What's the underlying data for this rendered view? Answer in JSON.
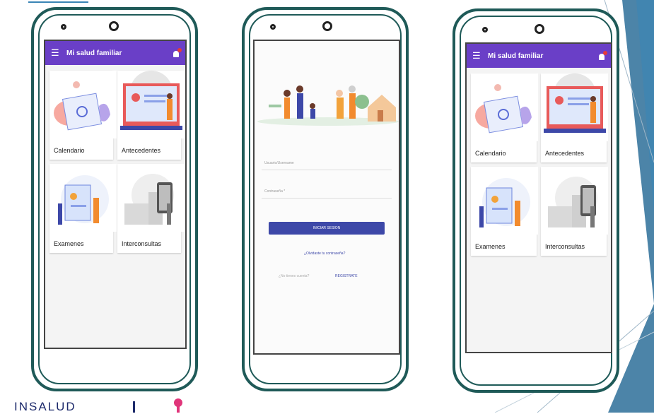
{
  "app": {
    "title": "Mi salud familiar",
    "menu_icon": "menu-icon",
    "notification_icon": "bell-icon",
    "brand_color": "#6a3fc7"
  },
  "dashboard": {
    "cards": [
      {
        "label": "Calendario"
      },
      {
        "label": "Antecedentes"
      },
      {
        "label": "Examenes"
      },
      {
        "label": "Interconsultas"
      }
    ]
  },
  "login": {
    "user_placeholder": "Usuario/Username",
    "password_placeholder": "Contraseña *",
    "login_button": "INICIAR SESION",
    "forgot_link": "¿Olvidaste tu contraseña?",
    "no_account_text": "¿No tienes cuenta?",
    "register_link": "REGISTRATE"
  },
  "footer": {
    "brand_text": "INSALUD"
  }
}
